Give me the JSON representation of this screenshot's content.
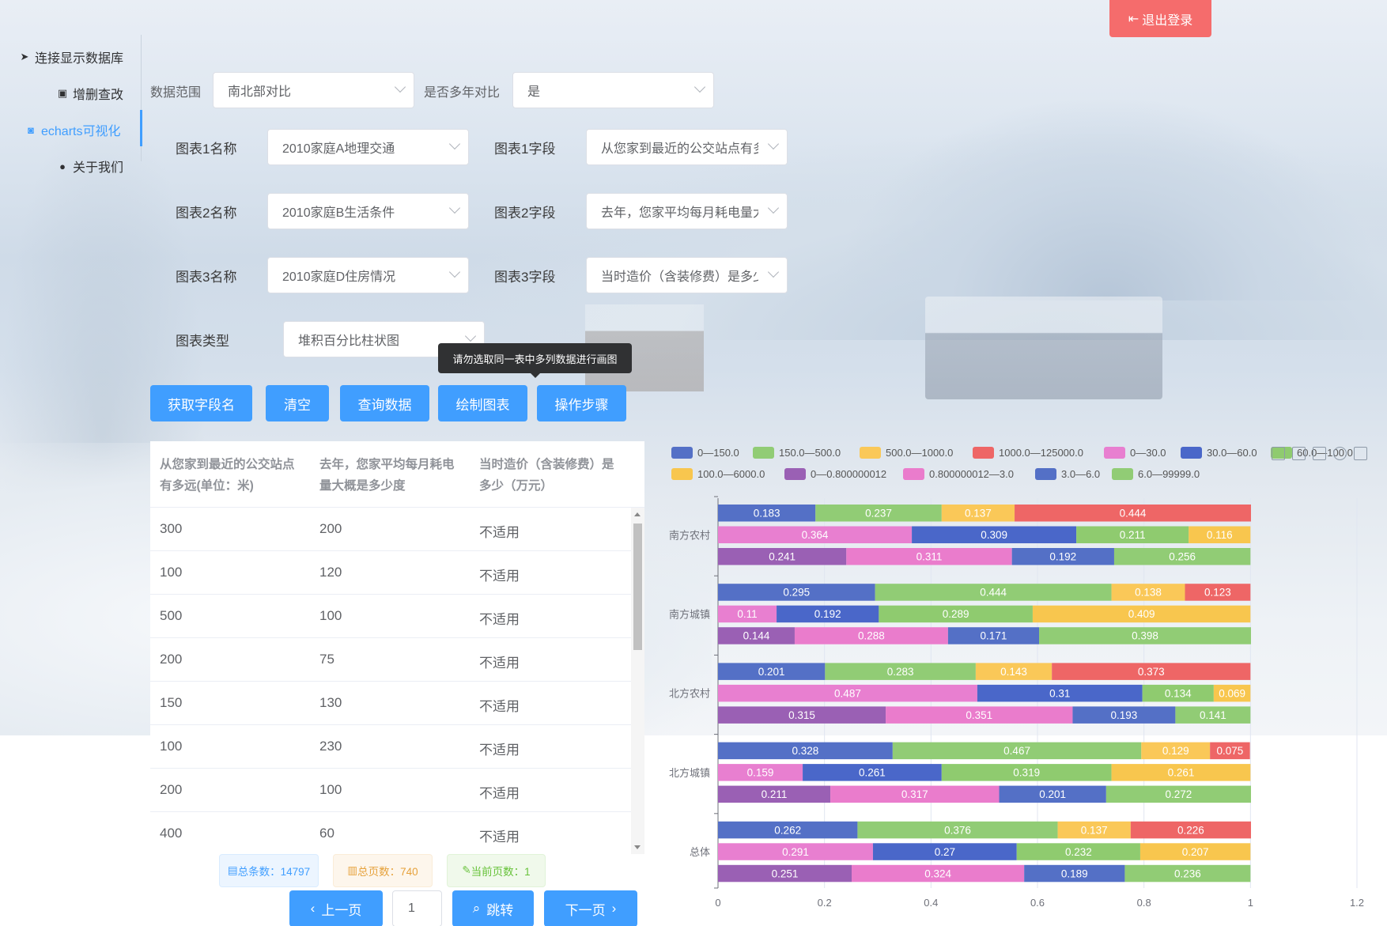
{
  "header": {
    "logout_label": "退出登录"
  },
  "sidebar": {
    "items": [
      {
        "label": "连接显示数据库",
        "icon": "send-icon"
      },
      {
        "label": "增删查改",
        "icon": "clipboard-icon"
      },
      {
        "label": "echarts可视化",
        "icon": "camera-icon",
        "active": true
      },
      {
        "label": "关于我们",
        "icon": "user-icon"
      }
    ]
  },
  "filters": {
    "range_label": "数据范围",
    "range_value": "南北部对比",
    "multiyear_label": "是否多年对比",
    "multiyear_value": "是",
    "chart1_name_label": "图表1名称",
    "chart1_name_value": "2010家庭A地理交通",
    "chart1_field_label": "图表1字段",
    "chart1_field_value": "从您家到最近的公交站点有多远",
    "chart2_name_label": "图表2名称",
    "chart2_name_value": "2010家庭B生活条件",
    "chart2_field_label": "图表2字段",
    "chart2_field_value": "去年，您家平均每月耗电量大概",
    "chart3_name_label": "图表3名称",
    "chart3_name_value": "2010家庭D住房情况",
    "chart3_field_label": "图表3字段",
    "chart3_field_value": "当时造价（含装修费）是多少",
    "chart_type_label": "图表类型",
    "chart_type_value": "堆积百分比柱状图"
  },
  "toolbar": {
    "get_fields": "获取字段名",
    "clear": "清空",
    "query": "查询数据",
    "draw": "绘制图表",
    "steps": "操作步骤",
    "tooltip": "请勿选取同一表中多列数据进行画图"
  },
  "table": {
    "headers": [
      "从您家到最近的公交站点有多远(单位：米)",
      "去年，您家平均每月耗电量大概是多少度",
      "当时造价（含装修费）是多少（万元）"
    ],
    "rows": [
      [
        "300",
        "200",
        "不适用"
      ],
      [
        "100",
        "120",
        "不适用"
      ],
      [
        "500",
        "100",
        "不适用"
      ],
      [
        "200",
        "75",
        "不适用"
      ],
      [
        "150",
        "130",
        "不适用"
      ],
      [
        "100",
        "230",
        "不适用"
      ],
      [
        "200",
        "100",
        "不适用"
      ],
      [
        "400",
        "60",
        "不适用"
      ]
    ]
  },
  "pagination": {
    "total_records": "总条数：14797",
    "total_pages": "总页数：740",
    "current_page": "当前页数：1",
    "prev": "上一页",
    "page_input": "1",
    "jump": "跳转",
    "next": "下一页"
  },
  "chart_data": {
    "type": "bar",
    "orientation": "horizontal",
    "stacked_percent": true,
    "categories": [
      "南方农村",
      "南方城镇",
      "北方农村",
      "北方城镇",
      "总体"
    ],
    "xlim": [
      0,
      1.2
    ],
    "xticks": [
      "0",
      "0.2",
      "0.4",
      "0.6",
      "0.8",
      "1",
      "1.2"
    ],
    "legend": [
      {
        "name": "0—150.0",
        "color": "#5470c6"
      },
      {
        "name": "150.0—500.0",
        "color": "#91cc75"
      },
      {
        "name": "500.0—1000.0",
        "color": "#fac858"
      },
      {
        "name": "1000.0—125000.0",
        "color": "#ee6666"
      },
      {
        "name": "0—30.0",
        "color": "#e87fd0"
      },
      {
        "name": "30.0—60.0",
        "color": "#4a67c9"
      },
      {
        "name": "60.0—100.0",
        "color": "#8fcb6f"
      },
      {
        "name": "100.0—6000.0",
        "color": "#f8c64e"
      },
      {
        "name": "0—0.800000012",
        "color": "#9a60b4"
      },
      {
        "name": "0.800000012—3.0",
        "color": "#ea7ccc"
      },
      {
        "name": "3.0—6.0",
        "color": "#5470c6"
      },
      {
        "name": "6.0—99999.0",
        "color": "#91cc75"
      }
    ],
    "groups": [
      {
        "category": "南方农村",
        "bars": [
          {
            "values": [
              0.183,
              0.237,
              0.137,
              0.444
            ],
            "colors": [
              "#5470c6",
              "#91cc75",
              "#fac858",
              "#ee6666"
            ]
          },
          {
            "values": [
              0.364,
              0.309,
              0.211,
              0.116
            ],
            "colors": [
              "#e87fd0",
              "#4a67c9",
              "#8fcb6f",
              "#f8c64e"
            ]
          },
          {
            "values": [
              0.241,
              0.311,
              0.192,
              0.256
            ],
            "colors": [
              "#9a60b4",
              "#ea7ccc",
              "#5470c6",
              "#91cc75"
            ]
          }
        ]
      },
      {
        "category": "南方城镇",
        "bars": [
          {
            "values": [
              0.295,
              0.444,
              0.138,
              0.123
            ],
            "colors": [
              "#5470c6",
              "#91cc75",
              "#fac858",
              "#ee6666"
            ]
          },
          {
            "values": [
              0.11,
              0.192,
              0.289,
              0.409
            ],
            "colors": [
              "#e87fd0",
              "#4a67c9",
              "#8fcb6f",
              "#f8c64e"
            ]
          },
          {
            "values": [
              0.144,
              0.288,
              0.171,
              0.398
            ],
            "colors": [
              "#9a60b4",
              "#ea7ccc",
              "#5470c6",
              "#91cc75"
            ]
          }
        ]
      },
      {
        "category": "北方农村",
        "bars": [
          {
            "values": [
              0.201,
              0.283,
              0.143,
              0.373
            ],
            "colors": [
              "#5470c6",
              "#91cc75",
              "#fac858",
              "#ee6666"
            ]
          },
          {
            "values": [
              0.487,
              0.31,
              0.134,
              0.069
            ],
            "colors": [
              "#e87fd0",
              "#4a67c9",
              "#8fcb6f",
              "#f8c64e"
            ]
          },
          {
            "values": [
              0.315,
              0.351,
              0.193,
              0.141
            ],
            "colors": [
              "#9a60b4",
              "#ea7ccc",
              "#5470c6",
              "#91cc75"
            ]
          }
        ]
      },
      {
        "category": "北方城镇",
        "bars": [
          {
            "values": [
              0.328,
              0.467,
              0.129,
              0.075
            ],
            "colors": [
              "#5470c6",
              "#91cc75",
              "#fac858",
              "#ee6666"
            ]
          },
          {
            "values": [
              0.159,
              0.261,
              0.319,
              0.261
            ],
            "colors": [
              "#e87fd0",
              "#4a67c9",
              "#8fcb6f",
              "#f8c64e"
            ]
          },
          {
            "values": [
              0.211,
              0.317,
              0.201,
              0.272
            ],
            "colors": [
              "#9a60b4",
              "#ea7ccc",
              "#5470c6",
              "#91cc75"
            ]
          }
        ]
      },
      {
        "category": "总体",
        "bars": [
          {
            "values": [
              0.262,
              0.376,
              0.137,
              0.226
            ],
            "colors": [
              "#5470c6",
              "#91cc75",
              "#fac858",
              "#ee6666"
            ]
          },
          {
            "values": [
              0.291,
              0.27,
              0.232,
              0.207
            ],
            "colors": [
              "#e87fd0",
              "#4a67c9",
              "#8fcb6f",
              "#f8c64e"
            ]
          },
          {
            "values": [
              0.251,
              0.324,
              0.189,
              0.236
            ],
            "colors": [
              "#9a60b4",
              "#ea7ccc",
              "#5470c6",
              "#91cc75"
            ]
          }
        ]
      }
    ]
  }
}
